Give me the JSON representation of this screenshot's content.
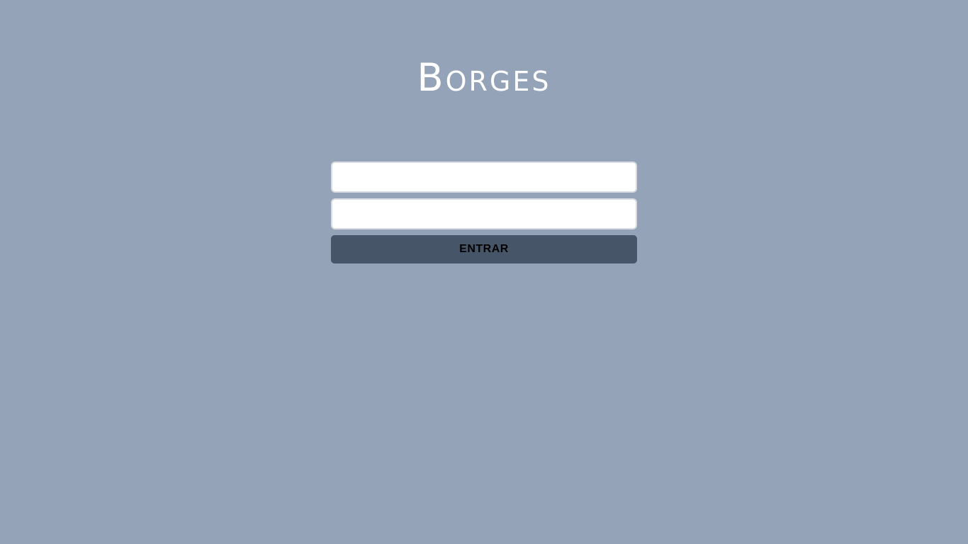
{
  "brand": {
    "logo_text": "Borges"
  },
  "login": {
    "username_value": "",
    "password_value": "",
    "submit_label": "ENTRAR"
  },
  "colors": {
    "background": "#94a3b8",
    "button": "#475569",
    "input_background": "#ffffff",
    "logo": "#ffffff"
  }
}
